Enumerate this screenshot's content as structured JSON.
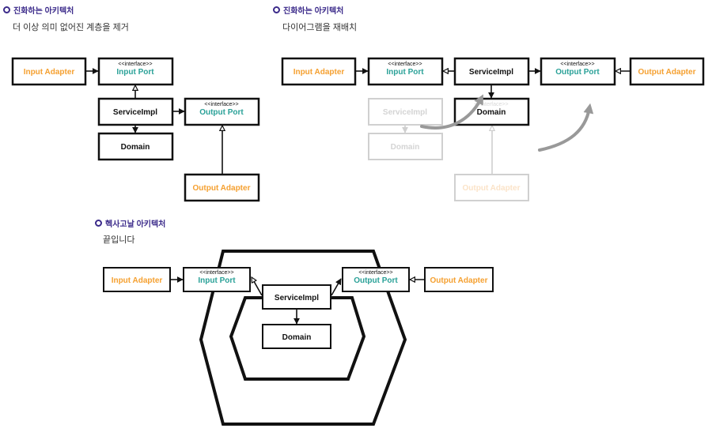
{
  "sections": [
    {
      "title": "진화하는 아키텍처",
      "subtitle": "더 이상 의미 없어진 계층을 제거"
    },
    {
      "title": "진화하는 아키텍처",
      "subtitle": "다이어그램을 재배치"
    },
    {
      "title": "헥사고날 아키텍처",
      "subtitle": "끝입니다"
    }
  ],
  "labels": {
    "interface_stereotype": "<<interface>>",
    "input_adapter": "Input Adapter",
    "input_port": "Input Port",
    "service_impl": "ServiceImpl",
    "output_port": "Output Port",
    "output_adapter": "Output Adapter",
    "domain": "Domain"
  },
  "colors": {
    "title": "#3b2a8a",
    "adapter": "#f5a030",
    "port": "#2aa198",
    "arrow_gray": "#999999"
  }
}
